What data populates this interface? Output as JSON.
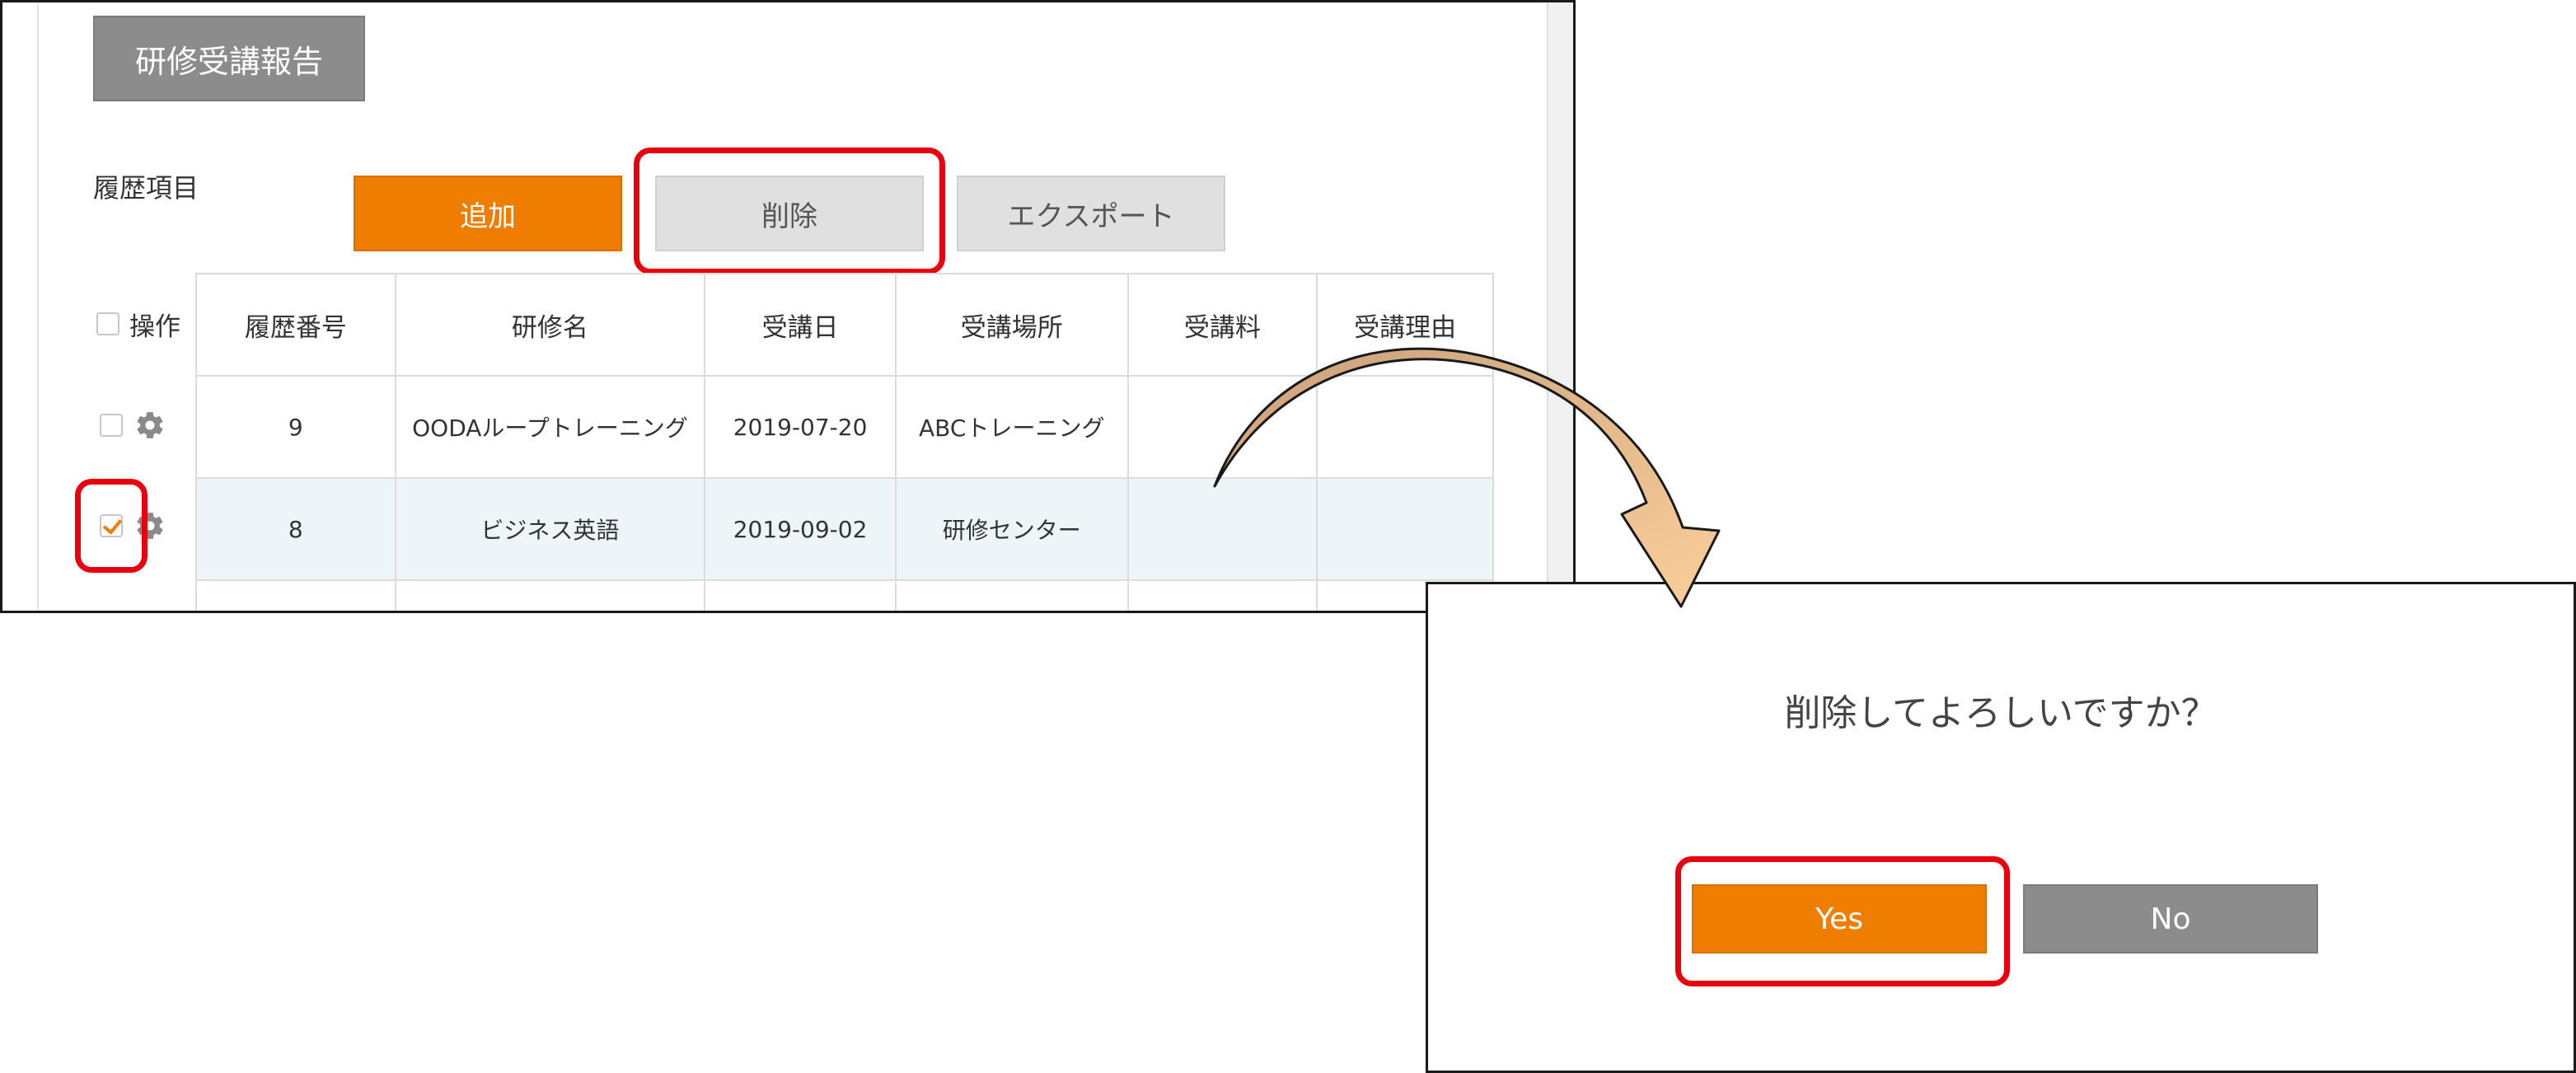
{
  "panel": {
    "report_tab": "研修受講報告",
    "history_label": "履歴項目",
    "buttons": {
      "add": "追加",
      "delete": "削除",
      "export": "エクスポート"
    },
    "table": {
      "ops_header": "操作",
      "columns": [
        "履歴番号",
        "研修名",
        "受講日",
        "受講場所",
        "受講料",
        "受講理由"
      ],
      "rows": [
        {
          "no": "9",
          "name": "OODAループトレーニング",
          "date": "2019-07-20",
          "place": "ABCトレーニング",
          "fee": "",
          "reason": "",
          "checked": false
        },
        {
          "no": "8",
          "name": "ビジネス英語",
          "date": "2019-09-02",
          "place": "研修センター",
          "fee": "",
          "reason": "",
          "checked": true
        }
      ]
    }
  },
  "dialog": {
    "message": "削除してよろしいですか？",
    "yes": "Yes",
    "no": "No"
  },
  "colors": {
    "accent_orange": "#ee7d00",
    "highlight_red": "#e8000f",
    "neutral_gray": "#8c8c8c",
    "arrow_fill": "#f8c690"
  }
}
